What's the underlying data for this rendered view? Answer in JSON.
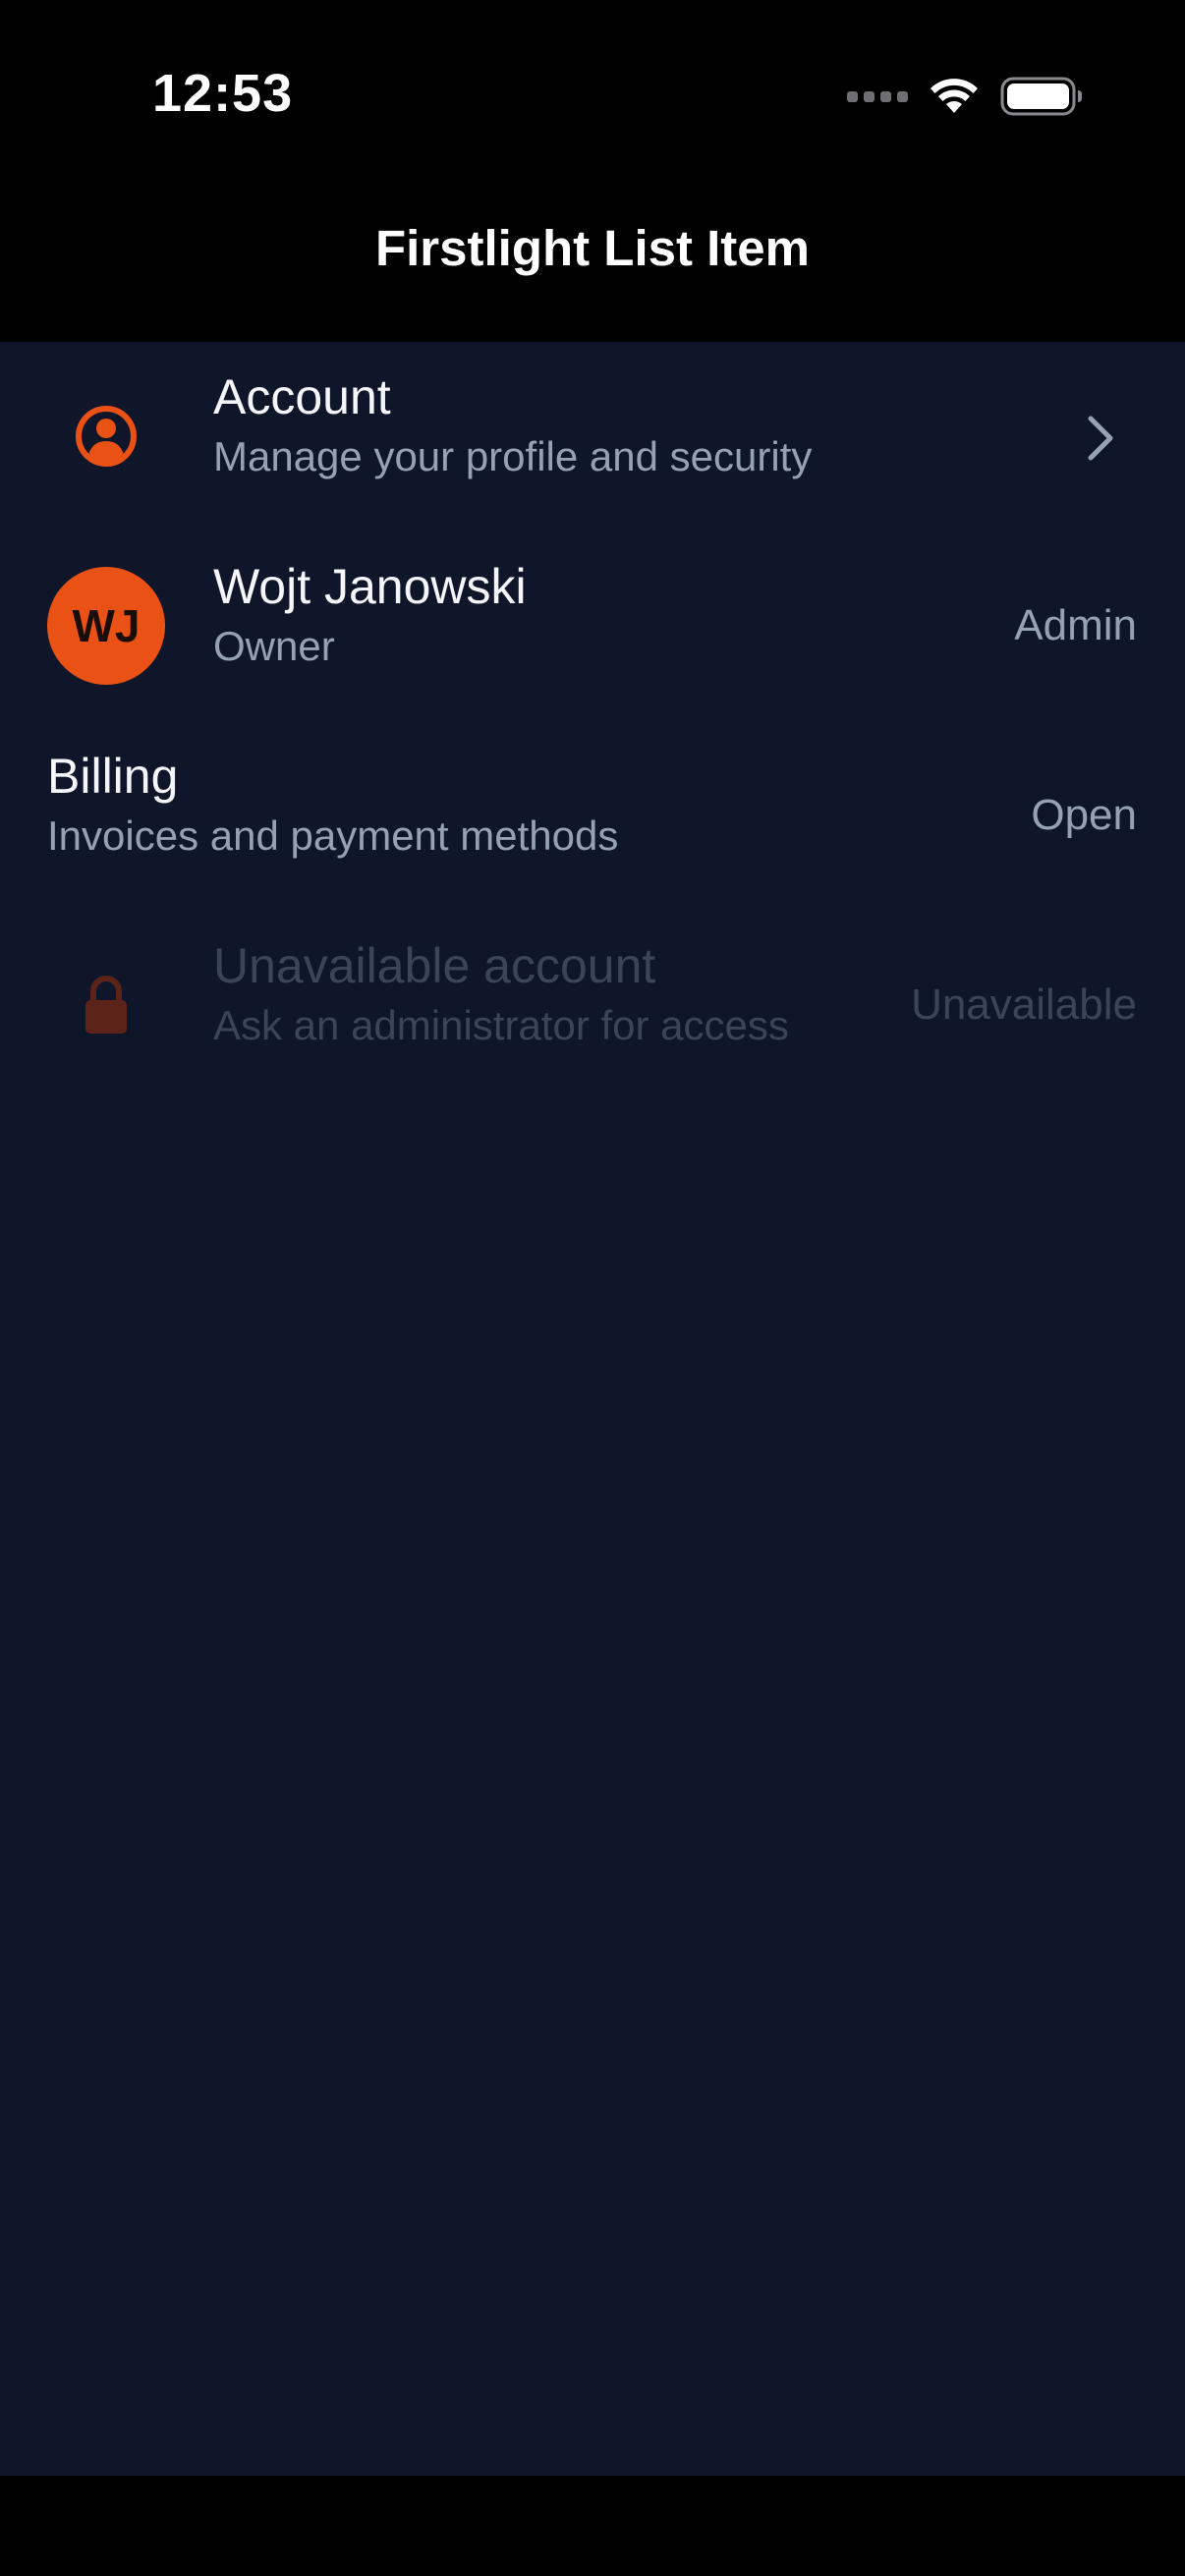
{
  "status_bar": {
    "time": "12:53"
  },
  "nav": {
    "title": "Firstlight List Item"
  },
  "list": {
    "items": [
      {
        "title": "Account",
        "subtitle": "Manage your profile and security",
        "leading_icon": "user-circle-icon",
        "trailing_icon": "chevron-right-icon"
      },
      {
        "title": "Wojt Janowski",
        "subtitle": "Owner",
        "avatar_initials": "WJ",
        "trailing": "Admin"
      },
      {
        "title": "Billing",
        "subtitle": "Invoices and payment methods",
        "trailing": "Open"
      },
      {
        "title": "Unavailable account",
        "subtitle": "Ask an administrator for access",
        "leading_icon": "lock-icon",
        "trailing": "Unavailable",
        "disabled": true
      }
    ]
  },
  "colors": {
    "background": "#101629",
    "accent": "#ea5115",
    "text_primary": "#f4f6fb",
    "text_secondary": "#97a1b4",
    "text_disabled": "#3b4459"
  }
}
